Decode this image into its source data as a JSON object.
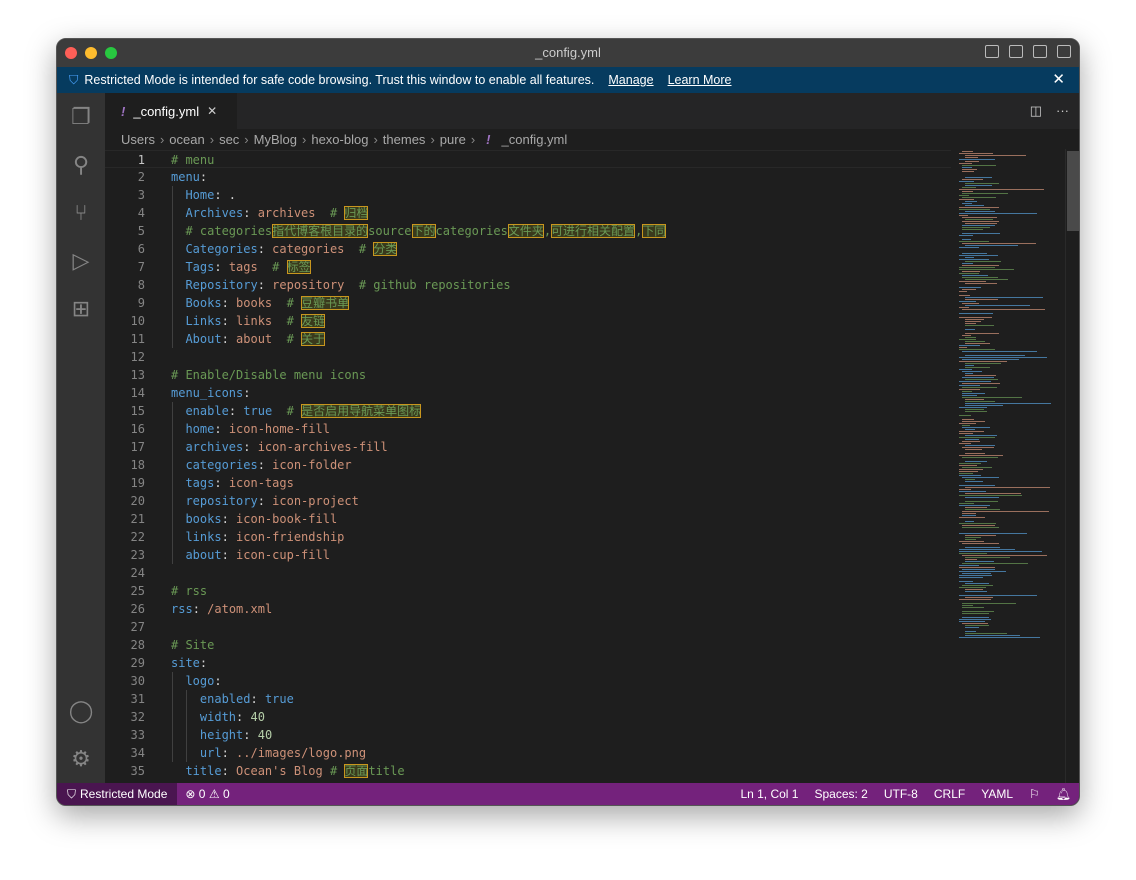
{
  "window": {
    "title": "_config.yml"
  },
  "banner": {
    "message": "Restricted Mode is intended for safe code browsing. Trust this window to enable all features.",
    "manage": "Manage",
    "learn_more": "Learn More",
    "close": "✕"
  },
  "tab": {
    "label": "_config.yml",
    "icon": "!",
    "close": "✕"
  },
  "breadcrumbs": [
    "Users",
    "ocean",
    "sec",
    "MyBlog",
    "hexo-blog",
    "themes",
    "pure"
  ],
  "breadcrumb_file": "_config.yml",
  "colors": {
    "key": "#569cd6",
    "string": "#ce9178",
    "comment": "#6a9955",
    "number": "#b5cea8",
    "status_bar": "#74227c",
    "banner": "#063b5f"
  },
  "lines": [
    [
      [
        "com",
        "# menu"
      ]
    ],
    [
      [
        "key",
        "menu"
      ],
      [
        "pun",
        ":"
      ]
    ],
    [
      [
        "pun",
        "  "
      ],
      [
        "key",
        "Home"
      ],
      [
        "pun",
        ": ."
      ]
    ],
    [
      [
        "pun",
        "  "
      ],
      [
        "key",
        "Archives"
      ],
      [
        "pun",
        ": "
      ],
      [
        "str",
        "archives"
      ],
      [
        "com",
        "  # "
      ],
      [
        "cjk",
        "归档"
      ]
    ],
    [
      [
        "pun",
        "  "
      ],
      [
        "com",
        "# categories"
      ],
      [
        "cjk",
        "指代博客根目录的"
      ],
      [
        "com",
        "source"
      ],
      [
        "cjk",
        "下的"
      ],
      [
        "com",
        "categories"
      ],
      [
        "cjk",
        "文件夹"
      ],
      [
        "com",
        ","
      ],
      [
        "cjk",
        "可进行相关配置"
      ],
      [
        "com",
        ","
      ],
      [
        "cjk",
        "下同"
      ]
    ],
    [
      [
        "pun",
        "  "
      ],
      [
        "key",
        "Categories"
      ],
      [
        "pun",
        ": "
      ],
      [
        "str",
        "categories"
      ],
      [
        "com",
        "  # "
      ],
      [
        "cjk",
        "分类"
      ]
    ],
    [
      [
        "pun",
        "  "
      ],
      [
        "key",
        "Tags"
      ],
      [
        "pun",
        ": "
      ],
      [
        "str",
        "tags"
      ],
      [
        "com",
        "  # "
      ],
      [
        "cjk",
        "标签"
      ]
    ],
    [
      [
        "pun",
        "  "
      ],
      [
        "key",
        "Repository"
      ],
      [
        "pun",
        ": "
      ],
      [
        "str",
        "repository"
      ],
      [
        "com",
        "  # github repositories"
      ]
    ],
    [
      [
        "pun",
        "  "
      ],
      [
        "key",
        "Books"
      ],
      [
        "pun",
        ": "
      ],
      [
        "str",
        "books"
      ],
      [
        "com",
        "  # "
      ],
      [
        "cjk",
        "豆瓣书单"
      ]
    ],
    [
      [
        "pun",
        "  "
      ],
      [
        "key",
        "Links"
      ],
      [
        "pun",
        ": "
      ],
      [
        "str",
        "links"
      ],
      [
        "com",
        "  # "
      ],
      [
        "cjk",
        "友链"
      ]
    ],
    [
      [
        "pun",
        "  "
      ],
      [
        "key",
        "About"
      ],
      [
        "pun",
        ": "
      ],
      [
        "str",
        "about"
      ],
      [
        "com",
        "  # "
      ],
      [
        "cjk",
        "关于"
      ]
    ],
    [],
    [
      [
        "com",
        "# Enable/Disable menu icons"
      ]
    ],
    [
      [
        "key",
        "menu_icons"
      ],
      [
        "pun",
        ":"
      ]
    ],
    [
      [
        "pun",
        "  "
      ],
      [
        "key",
        "enable"
      ],
      [
        "pun",
        ": "
      ],
      [
        "bool",
        "true"
      ],
      [
        "com",
        "  # "
      ],
      [
        "cjk",
        "是否启用导航菜单图标"
      ]
    ],
    [
      [
        "pun",
        "  "
      ],
      [
        "key",
        "home"
      ],
      [
        "pun",
        ": "
      ],
      [
        "str",
        "icon-home-fill"
      ]
    ],
    [
      [
        "pun",
        "  "
      ],
      [
        "key",
        "archives"
      ],
      [
        "pun",
        ": "
      ],
      [
        "str",
        "icon-archives-fill"
      ]
    ],
    [
      [
        "pun",
        "  "
      ],
      [
        "key",
        "categories"
      ],
      [
        "pun",
        ": "
      ],
      [
        "str",
        "icon-folder"
      ]
    ],
    [
      [
        "pun",
        "  "
      ],
      [
        "key",
        "tags"
      ],
      [
        "pun",
        ": "
      ],
      [
        "str",
        "icon-tags"
      ]
    ],
    [
      [
        "pun",
        "  "
      ],
      [
        "key",
        "repository"
      ],
      [
        "pun",
        ": "
      ],
      [
        "str",
        "icon-project"
      ]
    ],
    [
      [
        "pun",
        "  "
      ],
      [
        "key",
        "books"
      ],
      [
        "pun",
        ": "
      ],
      [
        "str",
        "icon-book-fill"
      ]
    ],
    [
      [
        "pun",
        "  "
      ],
      [
        "key",
        "links"
      ],
      [
        "pun",
        ": "
      ],
      [
        "str",
        "icon-friendship"
      ]
    ],
    [
      [
        "pun",
        "  "
      ],
      [
        "key",
        "about"
      ],
      [
        "pun",
        ": "
      ],
      [
        "str",
        "icon-cup-fill"
      ]
    ],
    [],
    [
      [
        "com",
        "# rss"
      ]
    ],
    [
      [
        "key",
        "rss"
      ],
      [
        "pun",
        ": "
      ],
      [
        "str",
        "/atom.xml"
      ]
    ],
    [],
    [
      [
        "com",
        "# Site"
      ]
    ],
    [
      [
        "key",
        "site"
      ],
      [
        "pun",
        ":"
      ]
    ],
    [
      [
        "pun",
        "  "
      ],
      [
        "key",
        "logo"
      ],
      [
        "pun",
        ":"
      ]
    ],
    [
      [
        "pun",
        "    "
      ],
      [
        "key",
        "enabled"
      ],
      [
        "pun",
        ": "
      ],
      [
        "bool",
        "true"
      ]
    ],
    [
      [
        "pun",
        "    "
      ],
      [
        "key",
        "width"
      ],
      [
        "pun",
        ": "
      ],
      [
        "num",
        "40"
      ]
    ],
    [
      [
        "pun",
        "    "
      ],
      [
        "key",
        "height"
      ],
      [
        "pun",
        ": "
      ],
      [
        "num",
        "40"
      ]
    ],
    [
      [
        "pun",
        "    "
      ],
      [
        "key",
        "url"
      ],
      [
        "pun",
        ": "
      ],
      [
        "str",
        "../images/logo.png"
      ]
    ],
    [
      [
        "pun",
        "  "
      ],
      [
        "key",
        "title"
      ],
      [
        "pun",
        ": "
      ],
      [
        "str",
        "Ocean's Blog"
      ],
      [
        "com",
        " # "
      ],
      [
        "cjk",
        "页面"
      ],
      [
        "com",
        "title"
      ]
    ]
  ],
  "status": {
    "restricted": "Restricted Mode",
    "errors": "0",
    "warnings": "0",
    "position": "Ln 1, Col 1",
    "spaces": "Spaces: 2",
    "encoding": "UTF-8",
    "eol": "CRLF",
    "language": "YAML"
  }
}
